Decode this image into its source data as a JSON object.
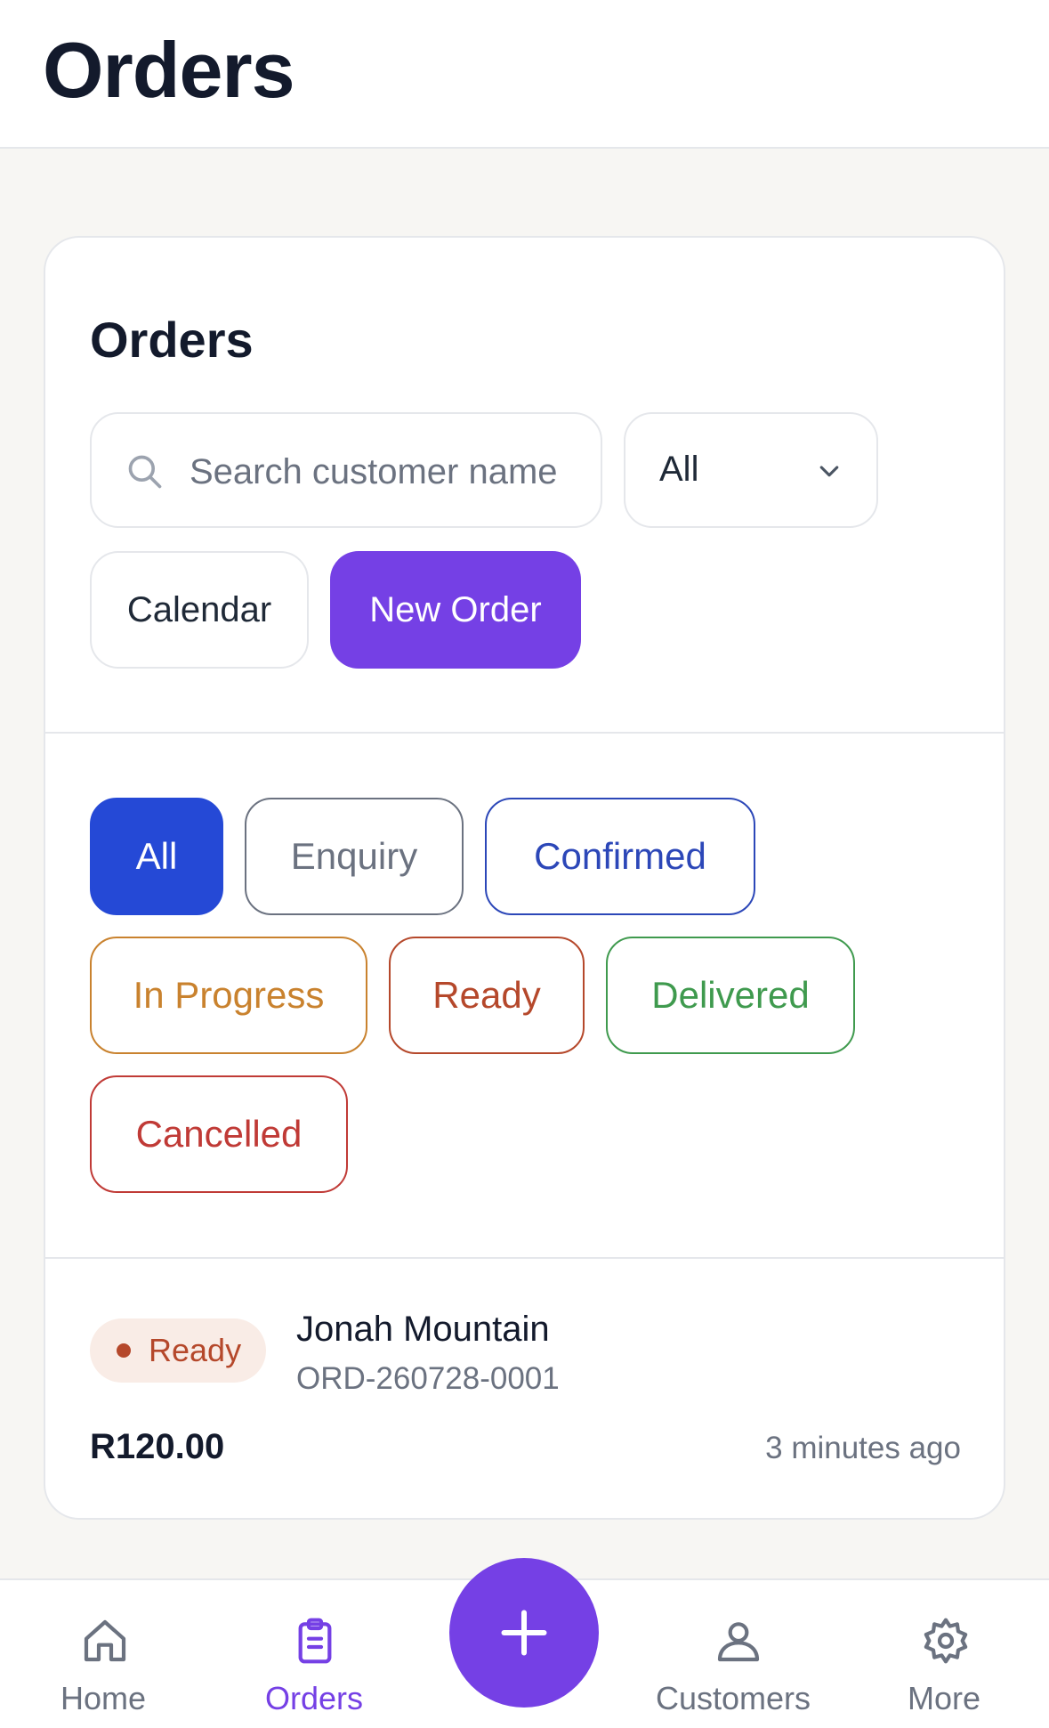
{
  "header": {
    "title": "Orders"
  },
  "card": {
    "title": "Orders",
    "search": {
      "placeholder": "Search customer name"
    },
    "status_select": {
      "value": "All"
    },
    "calendar_label": "Calendar",
    "new_order_label": "New Order"
  },
  "filters": [
    {
      "label": "All",
      "color": "#2549d6",
      "selected": true
    },
    {
      "label": "Enquiry",
      "color": "#6b7280",
      "selected": false
    },
    {
      "label": "Confirmed",
      "color": "#2c47b8",
      "selected": false
    },
    {
      "label": "In Progress",
      "color": "#c9822e",
      "selected": false
    },
    {
      "label": "Ready",
      "color": "#b5482b",
      "selected": false
    },
    {
      "label": "Delivered",
      "color": "#3f9a4e",
      "selected": false
    },
    {
      "label": "Cancelled",
      "color": "#c03a36",
      "selected": false
    }
  ],
  "orders": [
    {
      "status": "Ready",
      "customer": "Jonah Mountain",
      "order_id": "ORD-260728-0001",
      "amount": "R120.00",
      "time_ago": "3 minutes ago"
    }
  ],
  "nav": {
    "home": "Home",
    "orders": "Orders",
    "customers": "Customers",
    "more": "More",
    "active_color": "#7540e5",
    "inactive_color": "#6b7280"
  }
}
